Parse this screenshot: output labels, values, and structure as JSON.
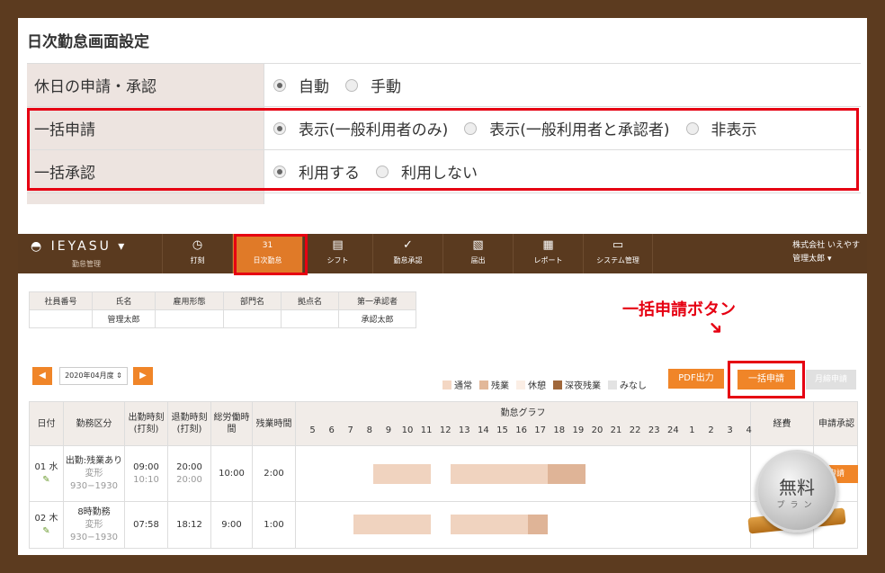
{
  "settings": {
    "title": "日次勤怠画面設定",
    "rows": [
      {
        "label": "休日の申請・承認",
        "options": [
          "自動",
          "手動"
        ],
        "selected": 0
      },
      {
        "label": "一括申請",
        "options": [
          "表示(一般利用者のみ)",
          "表示(一般利用者と承認者)",
          "非表示"
        ],
        "selected": 0
      },
      {
        "label": "一括承認",
        "options": [
          "利用する",
          "利用しない"
        ],
        "selected": 0
      }
    ]
  },
  "nav": {
    "brand": "IEYASU",
    "brand_sub": "勤怠管理",
    "items": [
      {
        "label": "打刻",
        "icon": "clock-icon",
        "glyph": "◷"
      },
      {
        "label": "日次勤怠",
        "icon": "calendar-icon",
        "glyph": "31"
      },
      {
        "label": "シフト",
        "icon": "notebook-icon",
        "glyph": "▤"
      },
      {
        "label": "勤怠承認",
        "icon": "check-icon",
        "glyph": "✓"
      },
      {
        "label": "届出",
        "icon": "document-add-icon",
        "glyph": "▧"
      },
      {
        "label": "レポート",
        "icon": "report-icon",
        "glyph": "▦"
      },
      {
        "label": "システム管理",
        "icon": "monitor-icon",
        "glyph": "▭"
      }
    ],
    "company": "株式会社 いえやす",
    "user": "管理太郎"
  },
  "info": {
    "headers": [
      "社員番号",
      "氏名",
      "雇用形態",
      "部門名",
      "拠点名",
      "第一承認者"
    ],
    "values": [
      "",
      "管理太郎",
      "",
      "",
      "",
      "承認太郎"
    ]
  },
  "callout": "一括申請ボタン",
  "month": "2020年04月度",
  "legend": [
    {
      "label": "通常",
      "color": "#f4d7c4"
    },
    {
      "label": "残業",
      "color": "#e2b89a"
    },
    {
      "label": "休憩",
      "color": "#fbeee5"
    },
    {
      "label": "深夜残業",
      "color": "#a0673a"
    },
    {
      "label": "みなし",
      "color": "#e3e3e3"
    }
  ],
  "buttons": {
    "pdf": "PDF出力",
    "bulk": "一括申請",
    "monthly": "月締申請",
    "apply": "申請"
  },
  "grid": {
    "headers": {
      "date": "日付",
      "type": "勤務区分",
      "start": "出勤時刻\n(打刻)",
      "end": "退勤時刻\n(打刻)",
      "total": "総労働時\n間",
      "overtime": "残業時間",
      "graph": "勤怠グラフ",
      "expense": "経費",
      "approve": "申請承認"
    },
    "hours": [
      "5",
      "6",
      "7",
      "8",
      "9",
      "10",
      "11",
      "12",
      "13",
      "14",
      "15",
      "16",
      "17",
      "18",
      "19",
      "20",
      "21",
      "22",
      "23",
      "24",
      "1",
      "2",
      "3",
      "4"
    ],
    "rows": [
      {
        "date": "01 水",
        "type": "出勤:残業あり",
        "pattern": "変形930−1930",
        "start": "09:00",
        "start_punch": "10:10",
        "end": "20:00",
        "end_punch": "20:00",
        "total": "10:00",
        "overtime": "2:00"
      },
      {
        "date": "02 木",
        "type": "8時勤務",
        "pattern": "変形930−1930",
        "start": "07:58",
        "start_punch": "",
        "end": "18:12",
        "end_punch": "",
        "total": "9:00",
        "overtime": "1:00"
      }
    ]
  },
  "badge": {
    "main": "無料",
    "sub": "プラン"
  }
}
